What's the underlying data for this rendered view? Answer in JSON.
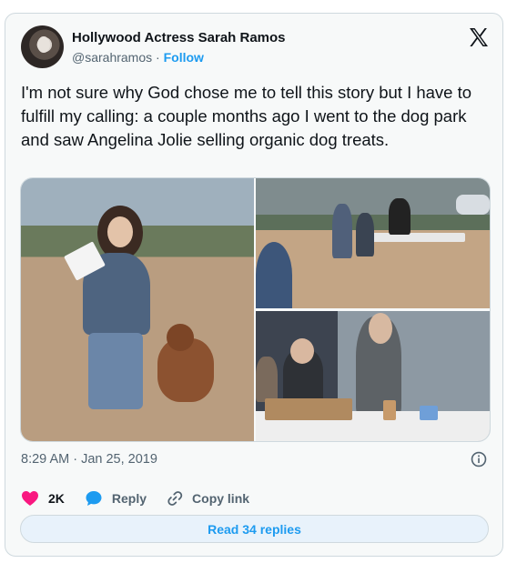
{
  "author": {
    "name": "Hollywood Actress Sarah Ramos",
    "handle": "@sarahramos",
    "separator": "·",
    "follow_label": "Follow"
  },
  "tweet": {
    "text": "I'm not sure why God chose me to tell this story but I have to fulfill my calling: a couple months ago I went to the dog park and saw Angelina Jolie selling organic dog treats.",
    "timestamp": "8:29 AM · Jan 25, 2019"
  },
  "actions": {
    "like_count": "2K",
    "reply_label": "Reply",
    "copy_link_label": "Copy link"
  },
  "read_replies_label": "Read 34 replies",
  "icons": {
    "logo": "x-logo-icon",
    "like": "heart-icon",
    "reply": "speech-bubble-icon",
    "copy": "link-icon",
    "info": "info-icon"
  },
  "colors": {
    "accent": "#1d9bf0",
    "heart": "#f91880",
    "muted": "#536471"
  }
}
